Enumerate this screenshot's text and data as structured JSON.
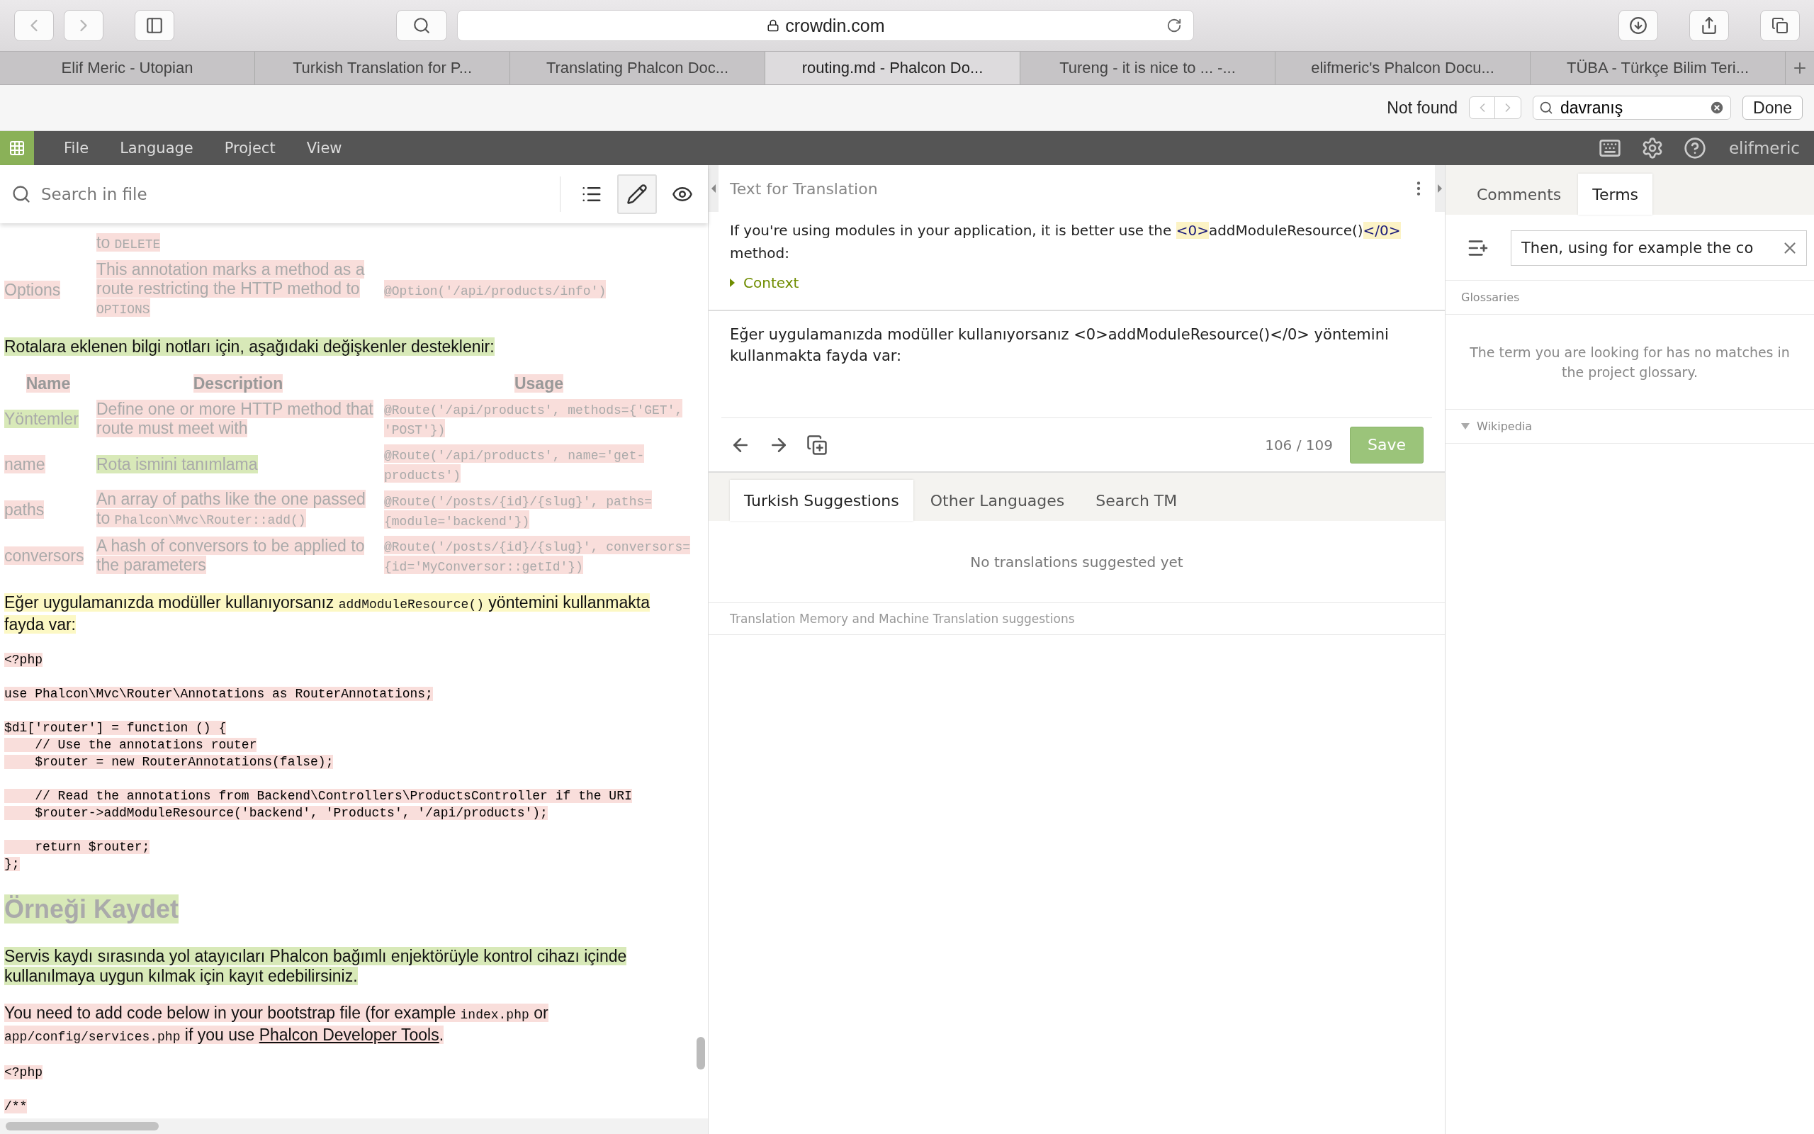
{
  "browser": {
    "url": "crowdin.com",
    "tabs": [
      {
        "title": "Elif Meric - Utopian",
        "selected": false
      },
      {
        "title": "Turkish Translation for P...",
        "selected": false
      },
      {
        "title": "Translating Phalcon Doc...",
        "selected": false
      },
      {
        "title": "routing.md - Phalcon Do...",
        "selected": true
      },
      {
        "title": "Tureng - it is nice to ... -...",
        "selected": false
      },
      {
        "title": "elifmeric's Phalcon Docu...",
        "selected": false
      },
      {
        "title": "TÜBA - Türkçe Bilim Teri...",
        "selected": false
      }
    ],
    "find": {
      "status": "Not found",
      "query": "davranış",
      "done": "Done"
    }
  },
  "app": {
    "menu": [
      "File",
      "Language",
      "Project",
      "View"
    ],
    "user": "elifmeric"
  },
  "doc": {
    "search_placeholder": "Search in file",
    "views": [
      {
        "kind": "outline",
        "selected": false
      },
      {
        "kind": "edit",
        "selected": true
      },
      {
        "kind": "preview",
        "selected": false
      }
    ],
    "blocks": [
      {
        "kind": "table",
        "rows": [
          [
            null,
            {
              "translated": false,
              "segs": [
                {
                  "text": "to "
                },
                {
                  "text": "DELETE",
                  "code": true
                }
              ]
            },
            null
          ],
          [
            {
              "translated": false,
              "segs": [
                {
                  "text": "Options"
                }
              ]
            },
            {
              "translated": false,
              "segs": [
                {
                  "text": "This annotation marks a method as a route restricting the HTTP method to "
                },
                {
                  "text": "OPTIONS",
                  "code": true
                }
              ]
            },
            {
              "translated": false,
              "segs": [
                {
                  "text": "@Option('/api/products/info')",
                  "code": true
                }
              ]
            }
          ]
        ]
      },
      {
        "kind": "paragraph",
        "translated": true,
        "selected": false,
        "segs": [
          {
            "text": "Rotalara eklenen bilgi notları için, aşağıdaki değişkenler desteklenir:"
          }
        ]
      },
      {
        "kind": "table",
        "header": [
          "Name",
          "Description",
          "Usage"
        ],
        "rows": [
          [
            {
              "translated": true,
              "segs": [
                {
                  "text": "Yöntemler"
                }
              ]
            },
            {
              "translated": false,
              "segs": [
                {
                  "text": "Define one or more HTTP method that route must meet with"
                }
              ]
            },
            {
              "translated": false,
              "segs": [
                {
                  "text": "@Route('/api/products', methods={'GET', 'POST'})",
                  "code": true
                }
              ]
            }
          ],
          [
            {
              "translated": false,
              "segs": [
                {
                  "text": "name"
                }
              ]
            },
            {
              "translated": true,
              "segs": [
                {
                  "text": "Rota ismini tanımlama"
                }
              ]
            },
            {
              "translated": false,
              "segs": [
                {
                  "text": "@Route('/api/products', name='get-products')",
                  "code": true
                }
              ]
            }
          ],
          [
            {
              "translated": false,
              "segs": [
                {
                  "text": "paths"
                }
              ]
            },
            {
              "translated": false,
              "segs": [
                {
                  "text": "An array of paths like the one passed to "
                },
                {
                  "text": "Phalcon\\Mvc\\Router::add()",
                  "code": true
                }
              ]
            },
            {
              "translated": false,
              "segs": [
                {
                  "text": "@Route('/posts/{id}/{slug}', paths={module='backend'})",
                  "code": true
                }
              ]
            }
          ],
          [
            {
              "translated": false,
              "segs": [
                {
                  "text": "conversors"
                }
              ]
            },
            {
              "translated": false,
              "segs": [
                {
                  "text": "A hash of conversors to be applied to the parameters"
                }
              ]
            },
            {
              "translated": false,
              "segs": [
                {
                  "text": "@Route('/posts/{id}/{slug}', conversors={id='MyConversor::getId'})",
                  "code": true
                }
              ]
            }
          ]
        ]
      },
      {
        "kind": "paragraph",
        "selected": true,
        "segs": [
          {
            "text": "Eğer uygulamanızda modüller kullanıyorsanız "
          },
          {
            "text": "addModuleResource()",
            "code": true
          },
          {
            "text": " yöntemini kullanmakta fayda var:"
          }
        ]
      },
      {
        "kind": "code",
        "translated": false,
        "selected": false,
        "lines": [
          "<?php"
        ]
      },
      {
        "kind": "code",
        "translated": false,
        "selected": false,
        "lines": [
          "use Phalcon\\Mvc\\Router\\Annotations as RouterAnnotations;"
        ]
      },
      {
        "kind": "code",
        "translated": false,
        "selected": false,
        "lines": [
          "$di['router'] = function () {",
          "    // Use the annotations router",
          "    $router = new RouterAnnotations(false);"
        ]
      },
      {
        "kind": "code",
        "translated": false,
        "selected": false,
        "lines": [
          "    // Read the annotations from Backend\\Controllers\\ProductsController if the URI",
          "    $router->addModuleResource('backend', 'Products', '/api/products');"
        ]
      },
      {
        "kind": "code",
        "translated": false,
        "selected": false,
        "lines": [
          "    return $router;",
          "};"
        ]
      },
      {
        "kind": "heading",
        "translated": true,
        "selected": false,
        "segs": [
          {
            "text": "Örneği Kaydet"
          }
        ]
      },
      {
        "kind": "paragraph",
        "translated": true,
        "selected": false,
        "segs": [
          {
            "text": "Servis kaydı sırasında yol atayıcıları Phalcon bağımlı enjektörüyle kontrol cihazı içinde kullanılmaya uygun kılmak için kayıt edebilirsiniz."
          }
        ]
      },
      {
        "kind": "paragraph",
        "translated": false,
        "selected": false,
        "segs": [
          {
            "text": "You need to add code below in your bootstrap file (for example "
          },
          {
            "text": "index.php",
            "code": true
          },
          {
            "text": " or "
          },
          {
            "text": "app/config/services.php",
            "code": true
          },
          {
            "text": " if you use "
          },
          {
            "text": "Phalcon Developer Tools",
            "link": true
          },
          {
            "text": "."
          }
        ]
      },
      {
        "kind": "code",
        "translated": false,
        "selected": false,
        "lines": [
          "<?php"
        ]
      },
      {
        "kind": "code",
        "translated": false,
        "selected": false,
        "lines": [
          "/**"
        ]
      }
    ]
  },
  "editor": {
    "title": "Text for Translation",
    "source": [
      {
        "text": "If you're using modules in your application, it is better use the "
      },
      {
        "text": "<0>",
        "tag": true
      },
      {
        "text": "addModuleResource()"
      },
      {
        "text": "</0>",
        "tag": true
      },
      {
        "text": " method:"
      }
    ],
    "context": {
      "label": "Context",
      "expanded": false
    },
    "translation": "Eğer uygulamanızda modüller kullanıyorsanız <0>addModuleResource()</0> yöntemini kullanmakta fayda var:",
    "counter": "106 / 109",
    "save": "Save",
    "tabs": [
      {
        "label": "Turkish Suggestions",
        "selected": true
      },
      {
        "label": "Other Languages",
        "selected": false
      },
      {
        "label": "Search TM",
        "selected": false
      }
    ],
    "empty": "No translations suggested yet",
    "footer": "Translation Memory and Machine Translation suggestions"
  },
  "side": {
    "tabs": [
      {
        "label": "Comments",
        "selected": false
      },
      {
        "label": "Terms",
        "selected": true
      }
    ],
    "term_value": "Then, using for example the co",
    "glossaries": "Glossaries",
    "message": "The term you are looking for has no matches in the project glossary.",
    "wikipedia": {
      "label": "Wikipedia",
      "expanded": true
    }
  }
}
